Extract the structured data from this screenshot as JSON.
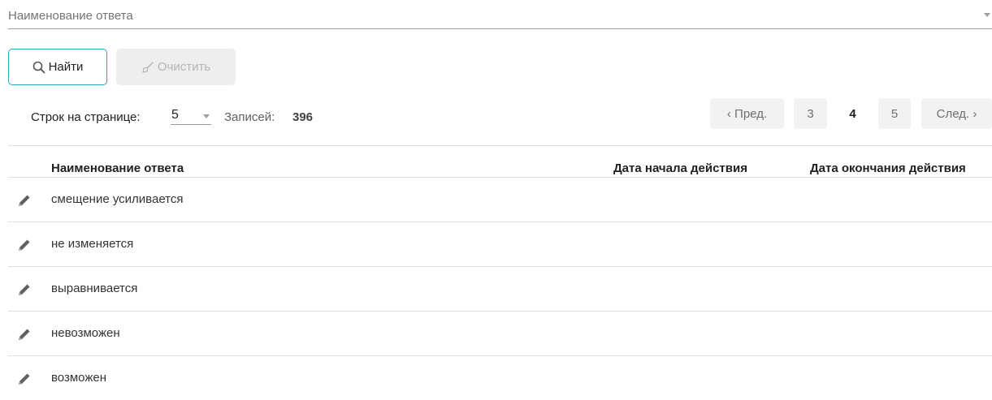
{
  "search": {
    "placeholder": "Наименование ответа",
    "value": ""
  },
  "buttons": {
    "find_label": "Найти",
    "clear_label": "Очистить"
  },
  "paging": {
    "rows_label": "Строк на странице:",
    "rows_value": "5",
    "records_label": "Записей:",
    "records_value": "396",
    "prev_label": "‹ Пред.",
    "next_label": "След. ›",
    "pages": [
      "3",
      "4",
      "5"
    ],
    "current_page": "4"
  },
  "table": {
    "headers": {
      "name": "Наименование ответа",
      "start_date": "Дата начала действия",
      "end_date": "Дата окончания действия"
    },
    "rows": [
      {
        "name": "смещение усиливается",
        "start_date": "",
        "end_date": ""
      },
      {
        "name": "не изменяется",
        "start_date": "",
        "end_date": ""
      },
      {
        "name": "выравнивается",
        "start_date": "",
        "end_date": ""
      },
      {
        "name": "невозможен",
        "start_date": "",
        "end_date": ""
      },
      {
        "name": "возможен",
        "start_date": "",
        "end_date": ""
      }
    ]
  },
  "colors": {
    "accent": "#2aa7b4",
    "divider": "#e0e0e0",
    "pager_bg": "#f2f2f2",
    "disabled_text": "#b5b5b5"
  },
  "icons": {
    "search": "search-icon",
    "clear": "broom-icon",
    "edit": "pencil-icon",
    "dropdown": "chevron-down-icon"
  }
}
